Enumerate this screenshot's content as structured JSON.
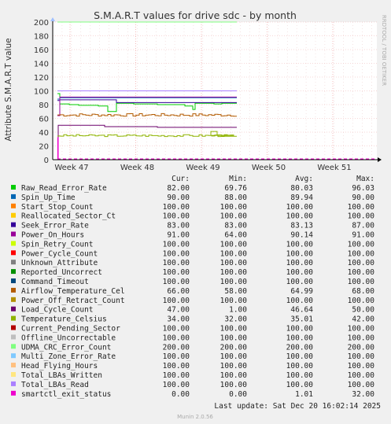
{
  "chart_data": {
    "type": "line",
    "title": "S.M.A.R.T values for drive sdc - by month",
    "ylabel": "Attribute S.M.A.R.T value",
    "side_label": "RRDTOOL / TOBI OETIKER",
    "ylim": [
      0,
      200
    ],
    "yticks": [
      0,
      20,
      40,
      60,
      80,
      100,
      120,
      140,
      160,
      180,
      200
    ],
    "xticks": [
      "Week 47",
      "Week 48",
      "Week 49",
      "Week 50",
      "Week 51"
    ],
    "columns": [
      "Cur:",
      "Min:",
      "Avg:",
      "Max:"
    ],
    "footer_update": "Last update: Sat Dec 20 16:02:14 2025",
    "footer_version": "Munin 2.0.56",
    "series": [
      {
        "name": "Raw_Read_Error_Rate",
        "color": "#00cc00",
        "cur": "82.00",
        "min": "69.76",
        "avg": "80.03",
        "max": "96.03"
      },
      {
        "name": "Spin_Up_Time",
        "color": "#0066b3",
        "cur": "90.00",
        "min": "88.00",
        "avg": "89.94",
        "max": "90.00"
      },
      {
        "name": "Start_Stop_Count",
        "color": "#ff8000",
        "cur": "100.00",
        "min": "100.00",
        "avg": "100.00",
        "max": "100.00"
      },
      {
        "name": "Reallocated_Sector_Ct",
        "color": "#ffcc00",
        "cur": "100.00",
        "min": "100.00",
        "avg": "100.00",
        "max": "100.00"
      },
      {
        "name": "Seek_Error_Rate",
        "color": "#330099",
        "cur": "83.00",
        "min": "83.00",
        "avg": "83.13",
        "max": "87.00"
      },
      {
        "name": "Power_On_Hours",
        "color": "#990099",
        "cur": "91.00",
        "min": "64.00",
        "avg": "90.14",
        "max": "91.00"
      },
      {
        "name": "Spin_Retry_Count",
        "color": "#ccff00",
        "cur": "100.00",
        "min": "100.00",
        "avg": "100.00",
        "max": "100.00"
      },
      {
        "name": "Power_Cycle_Count",
        "color": "#ff0000",
        "cur": "100.00",
        "min": "100.00",
        "avg": "100.00",
        "max": "100.00"
      },
      {
        "name": "Unknown_Attribute",
        "color": "#808080",
        "cur": "100.00",
        "min": "100.00",
        "avg": "100.00",
        "max": "100.00"
      },
      {
        "name": "Reported_Uncorrect",
        "color": "#008f00",
        "cur": "100.00",
        "min": "100.00",
        "avg": "100.00",
        "max": "100.00"
      },
      {
        "name": "Command_Timeout",
        "color": "#00487d",
        "cur": "100.00",
        "min": "100.00",
        "avg": "100.00",
        "max": "100.00"
      },
      {
        "name": "Airflow_Temperature_Cel",
        "color": "#b35a00",
        "cur": "66.00",
        "min": "58.00",
        "avg": "64.99",
        "max": "68.00"
      },
      {
        "name": "Power_Off_Retract_Count",
        "color": "#b38f00",
        "cur": "100.00",
        "min": "100.00",
        "avg": "100.00",
        "max": "100.00"
      },
      {
        "name": "Load_Cycle_Count",
        "color": "#6b006b",
        "cur": "47.00",
        "min": "1.00",
        "avg": "46.64",
        "max": "50.00"
      },
      {
        "name": "Temperature_Celsius",
        "color": "#8fb300",
        "cur": "34.00",
        "min": "32.00",
        "avg": "35.01",
        "max": "42.00"
      },
      {
        "name": "Current_Pending_Sector",
        "color": "#b30000",
        "cur": "100.00",
        "min": "100.00",
        "avg": "100.00",
        "max": "100.00"
      },
      {
        "name": "Offline_Uncorrectable",
        "color": "#bebebe",
        "cur": "100.00",
        "min": "100.00",
        "avg": "100.00",
        "max": "100.00"
      },
      {
        "name": "UDMA_CRC_Error_Count",
        "color": "#80ff80",
        "cur": "200.00",
        "min": "200.00",
        "avg": "200.00",
        "max": "200.00"
      },
      {
        "name": "Multi_Zone_Error_Rate",
        "color": "#80c9ff",
        "cur": "100.00",
        "min": "100.00",
        "avg": "100.00",
        "max": "100.00"
      },
      {
        "name": "Head_Flying_Hours",
        "color": "#ffc080",
        "cur": "100.00",
        "min": "100.00",
        "avg": "100.00",
        "max": "100.00"
      },
      {
        "name": "Total_LBAs_Written",
        "color": "#ffe680",
        "cur": "100.00",
        "min": "100.00",
        "avg": "100.00",
        "max": "100.00"
      },
      {
        "name": "Total_LBAs_Read",
        "color": "#aa80ff",
        "cur": "100.00",
        "min": "100.00",
        "avg": "100.00",
        "max": "100.00"
      },
      {
        "name": "smartctl_exit_status",
        "color": "#ee00cc",
        "cur": "0.00",
        "min": "0.00",
        "avg": "1.01",
        "max": "32.00"
      }
    ]
  }
}
